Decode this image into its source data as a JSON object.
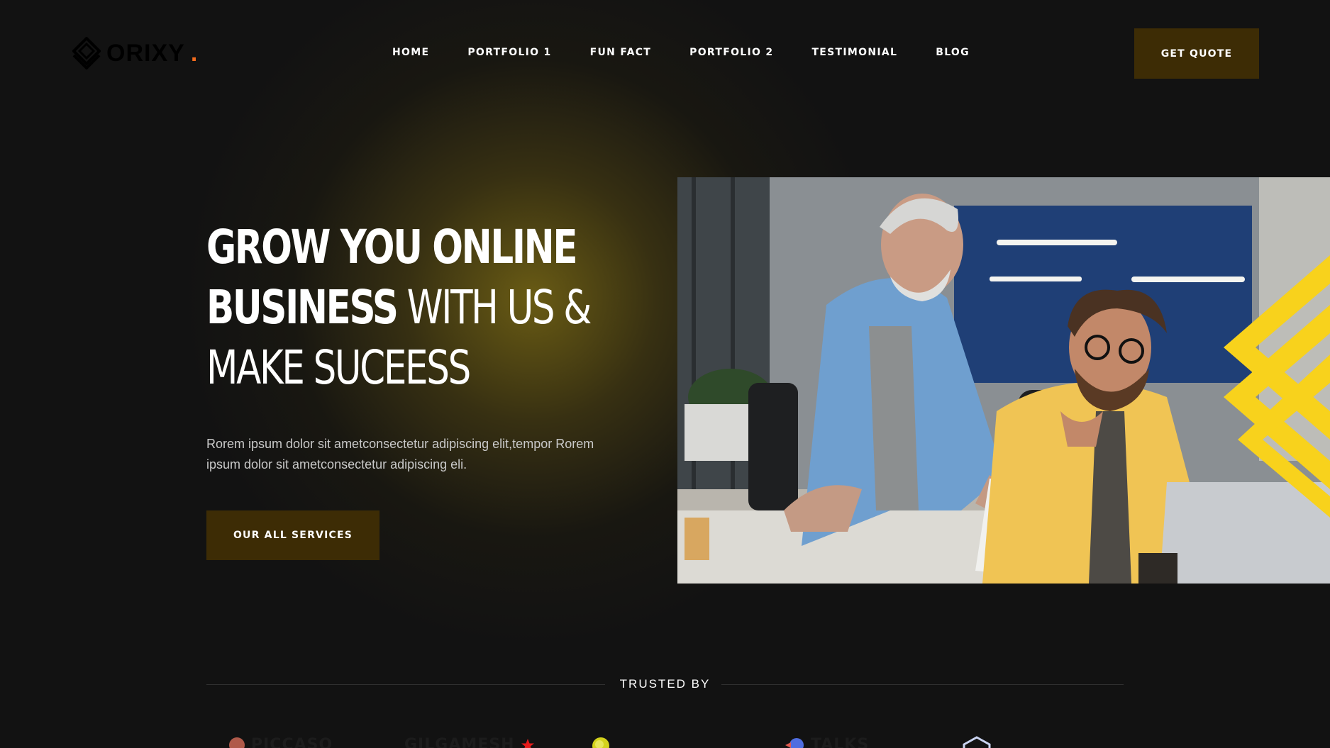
{
  "brand": {
    "name": "ORIXY",
    "dot": ".",
    "accent_color": "#f26b1d"
  },
  "nav": {
    "items": [
      {
        "label": "HOME"
      },
      {
        "label": "PORTFOLIO 1"
      },
      {
        "label": "FUN FACT"
      },
      {
        "label": "PORTFOLIO 2"
      },
      {
        "label": "TESTIMONIAL"
      },
      {
        "label": "BLOG"
      }
    ],
    "cta_label": "GET QUOTE"
  },
  "hero": {
    "headline_bold_1": "GROW YOU ONLINE",
    "headline_bold_2": "BUSINESS",
    "headline_light_2": " WITH US &",
    "headline_light_3": "MAKE SUCEESS",
    "description": "Rorem ipsum dolor sit ametconsectetur adipiscing elit,tempor Rorem ipsum dolor sit ametconsectetur adipiscing eli.",
    "button_label": "OUR ALL SERVICES",
    "image_icon": "office-meeting-photo"
  },
  "trusted": {
    "label": "TRUSTED BY",
    "logos": [
      {
        "name": "PICCASO",
        "icon": "circle-logo-icon"
      },
      {
        "name": "GILGAMESH",
        "icon": "star-logo-icon"
      },
      {
        "name": "",
        "icon": "color-orb-logo-icon"
      },
      {
        "name": "TALKS",
        "icon": "chat-logo-icon"
      },
      {
        "name": "",
        "icon": "hexagon-logo-icon"
      }
    ]
  },
  "colors": {
    "background": "#121212",
    "button": "#3d2c05",
    "yellow_accent": "#f8d21c"
  }
}
